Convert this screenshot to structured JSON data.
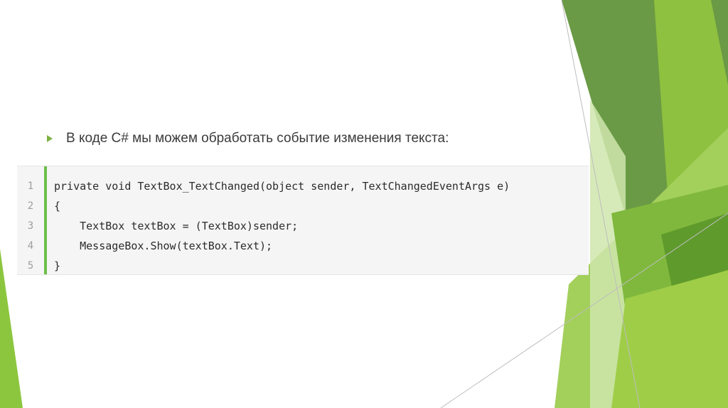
{
  "slide": {
    "bullet_text": "В коде C# мы можем обработать событие изменения текста:"
  },
  "code": {
    "line_numbers": [
      "1",
      "2",
      "3",
      "4",
      "5"
    ],
    "lines": [
      "private void TextBox_TextChanged(object sender, TextChangedEventArgs e)",
      "{",
      "    TextBox textBox = (TextBox)sender;",
      "    MessageBox.Show(textBox.Text);",
      "}"
    ]
  },
  "colors": {
    "accent_green": "#7cb342",
    "gutter_bar": "#6cbf4a",
    "code_background": "#f5f5f5"
  }
}
